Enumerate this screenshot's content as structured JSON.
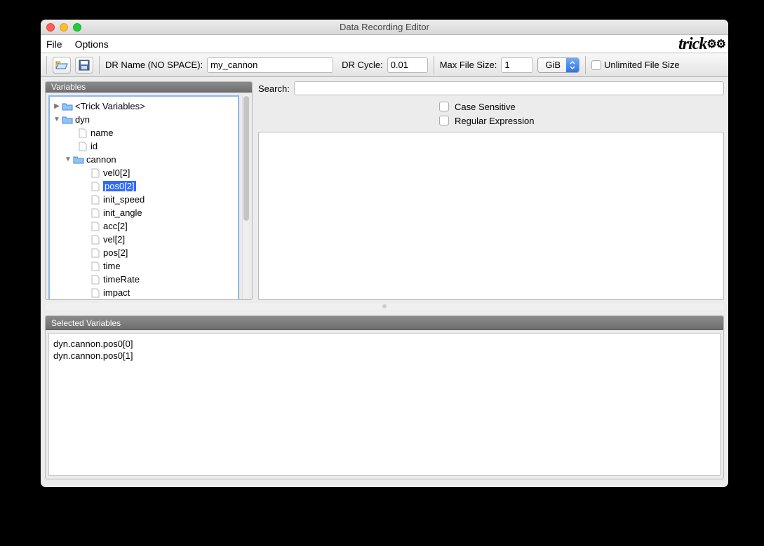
{
  "window": {
    "title": "Data Recording Editor"
  },
  "menubar": {
    "file": "File",
    "options": "Options",
    "brand": "trick"
  },
  "toolbar": {
    "dr_name_label": "DR Name (NO SPACE):",
    "dr_name_value": "my_cannon",
    "dr_cycle_label": "DR Cycle:",
    "dr_cycle_value": "0.01",
    "max_file_label": "Max File Size:",
    "max_file_value": "1",
    "unit_label": "GiB",
    "unlimited_label": "Unlimited File Size"
  },
  "variables": {
    "header": "Variables",
    "tree": {
      "root1": "<Trick Variables>",
      "dyn": "dyn",
      "name": "name",
      "id": "id",
      "cannon": "cannon",
      "vel0": "vel0[2]",
      "pos0": "pos0[2]",
      "init_speed": "init_speed",
      "init_angle": "init_angle",
      "acc": "acc[2]",
      "vel": "vel[2]",
      "pos": "pos[2]",
      "time": "time",
      "timeRate": "timeRate",
      "impact": "impact"
    }
  },
  "search": {
    "label": "Search:",
    "placeholder": "",
    "case_sensitive": "Case Sensitive",
    "regex": "Regular Expression"
  },
  "selected": {
    "header": "Selected Variables",
    "items": [
      "dyn.cannon.pos0[0]",
      "dyn.cannon.pos0[1]"
    ]
  }
}
